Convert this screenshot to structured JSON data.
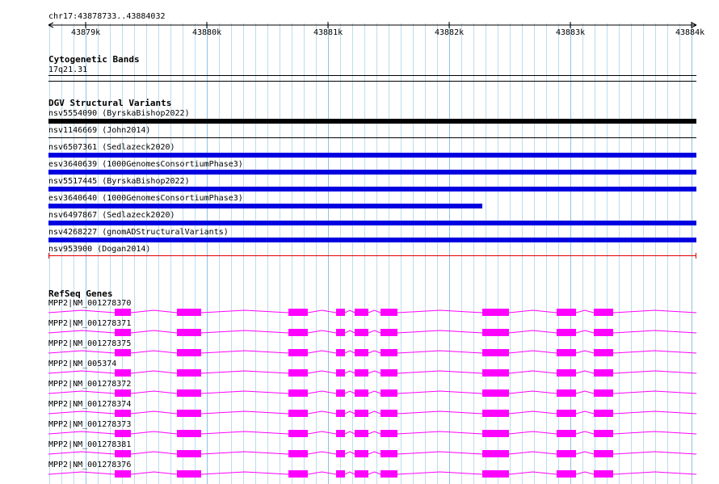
{
  "location": "chr17:43878733..43884032",
  "ruler": {
    "labels": [
      "43879k",
      "43880k",
      "43881k",
      "43882k",
      "43883k",
      "43884k"
    ]
  },
  "cytoband": {
    "title": "Cytogenetic Bands",
    "band": "17q21.31"
  },
  "dgv": {
    "title": "DGV Structural Variants",
    "features": [
      {
        "name": "nsv5554090",
        "source": "(ByrskaBishop2022)",
        "color": "#000000",
        "end": 1.0
      },
      {
        "name": "nsv1146669",
        "source": "(John2014)",
        "color": "#000000",
        "end": 1.0
      },
      {
        "name": "nsv6507361",
        "source": "(Sedlazeck2020)",
        "color": "#0000e0",
        "end": 1.0
      },
      {
        "name": "esv3640639",
        "source": "(1000GenomesConsortiumPhase3)",
        "color": "#0000e0",
        "end": 1.0
      },
      {
        "name": "nsv5517445",
        "source": "(ByrskaBishop2022)",
        "color": "#0000e0",
        "end": 1.0
      },
      {
        "name": "esv3640640",
        "source": "(1000GenomesConsortiumPhase3)",
        "color": "#0000e0",
        "end": 0.67
      },
      {
        "name": "nsv6497867",
        "source": "(Sedlazeck2020)",
        "color": "#0000e0",
        "end": 1.0
      },
      {
        "name": "nsv4268227",
        "source": "(gnomADStructuralVariants)",
        "color": "#0000e0",
        "end": 1.0
      },
      {
        "name": "nsv953900",
        "source": "(Dogan2014)",
        "color": "#e00000",
        "end": 1.0
      }
    ]
  },
  "refseq": {
    "title": "RefSeq Genes",
    "color": "#ff00ff",
    "transcripts": [
      "MPP2|NM_001278370",
      "MPP2|NM_001278371",
      "MPP2|NM_001278375",
      "MPP2|NM_005374",
      "MPP2|NM_001278372",
      "MPP2|NM_001278374",
      "MPP2|NM_001278373",
      "MPP2|NM_001278381",
      "MPP2|NM_001278376"
    ]
  },
  "colors": {
    "grid_minor": "#bcdcef",
    "grid_major": "#8ec4e3"
  }
}
